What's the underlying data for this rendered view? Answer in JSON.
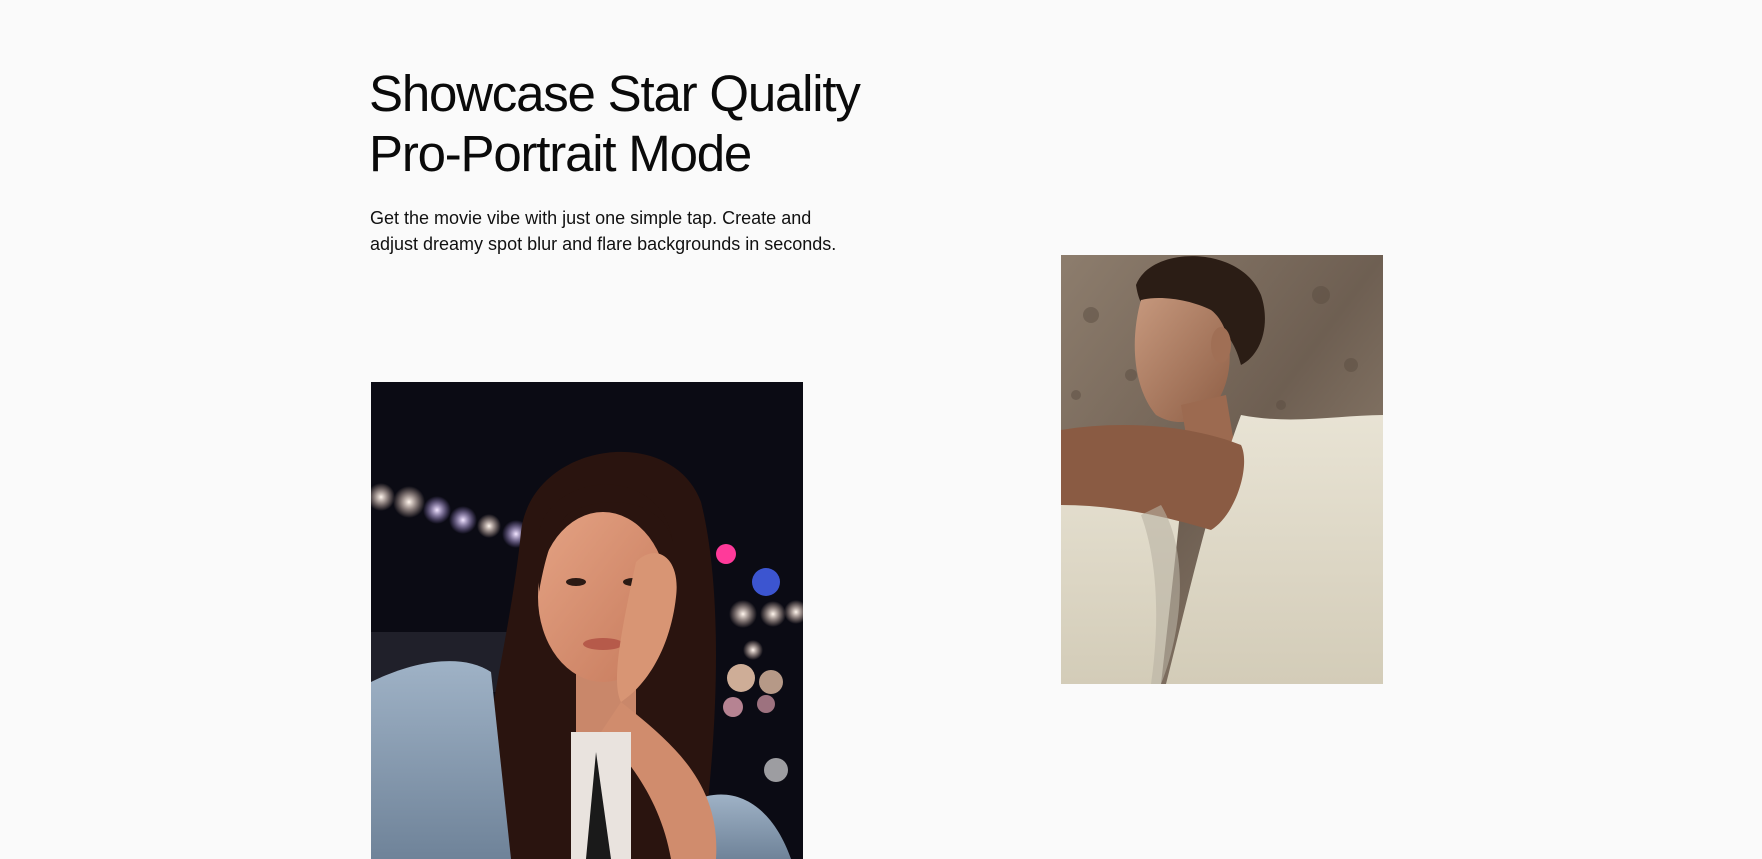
{
  "hero": {
    "title_line1": "Showcase Star Quality",
    "title_line2": "Pro-Portrait Mode",
    "description_line1": "Get the movie vibe with just one simple tap. Create and",
    "description_line2": "adjust dreamy spot blur and flare backgrounds in seconds."
  },
  "gallery": {
    "images": [
      {
        "subject": "woman-night-bokeh-portrait"
      },
      {
        "subject": "man-rock-backdrop-portrait"
      }
    ]
  },
  "colors": {
    "page_background": "#fafafa",
    "text": "#0a0a0a"
  }
}
